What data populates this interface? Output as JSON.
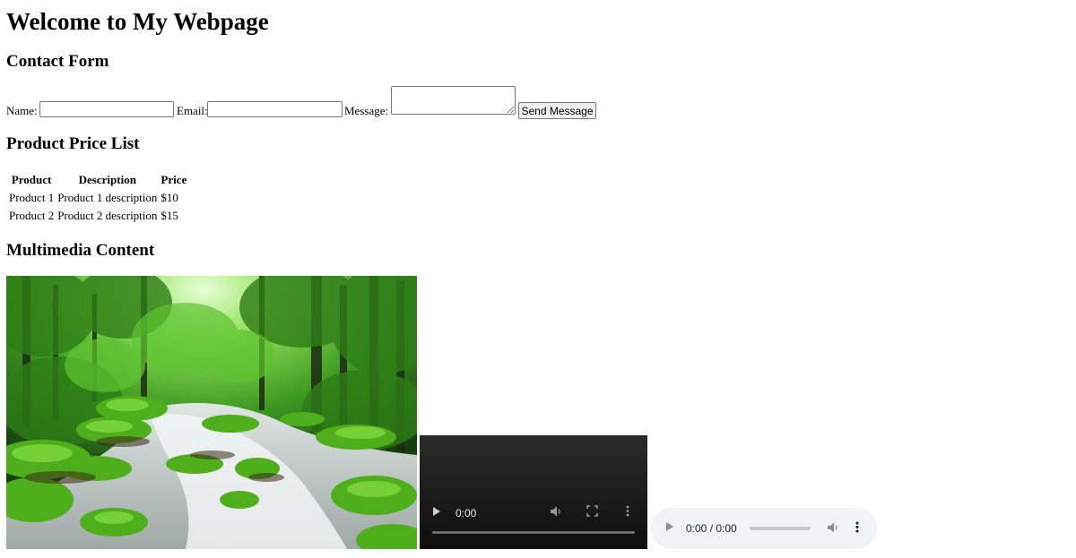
{
  "page": {
    "title": "Welcome to My Webpage"
  },
  "contact_form": {
    "title": "Contact Form",
    "name_label": "Name:",
    "name_value": "",
    "email_label": "Email:",
    "email_value": "",
    "message_label": "Message:",
    "message_value": "",
    "submit_label": "Send Message"
  },
  "price_list": {
    "title": "Product Price List",
    "columns": [
      "Product",
      "Description",
      "Price"
    ],
    "rows": [
      [
        "Product 1",
        "Product 1 description",
        "$10"
      ],
      [
        "Product 2",
        "Product 2 description",
        "$15"
      ]
    ]
  },
  "multimedia": {
    "title": "Multimedia Content",
    "image_icon": "forest-stream-image",
    "video": {
      "time": "0:00",
      "progress": 0,
      "icons": [
        "play-icon",
        "volume-icon",
        "fullscreen-icon",
        "more-options-icon"
      ]
    },
    "audio": {
      "time": "0:00 / 0:00",
      "progress": 0,
      "icons": [
        "play-icon",
        "volume-icon",
        "more-options-icon"
      ]
    }
  }
}
